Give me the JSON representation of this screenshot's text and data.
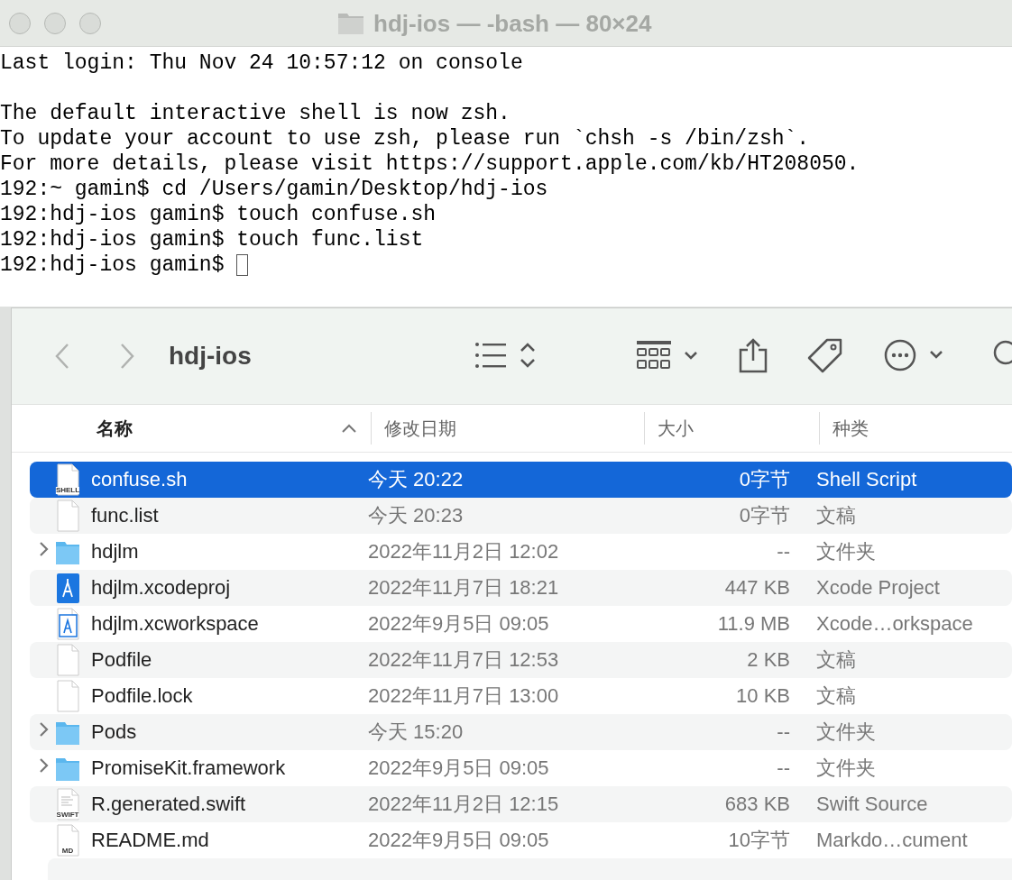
{
  "terminal": {
    "title": "hdj-ios — -bash — 80×24",
    "paragraphs": [
      [
        "Last login: Thu Nov 24 10:57:12 on console"
      ],
      [
        "The default interactive shell is now zsh.",
        "To update your account to use zsh, please run `chsh -s /bin/zsh`.",
        "For more details, please visit https://support.apple.com/kb/HT208050.",
        "192:~ gamin$ cd /Users/gamin/Desktop/hdj-ios",
        "192:hdj-ios gamin$ touch confuse.sh",
        "192:hdj-ios gamin$ touch func.list",
        "192:hdj-ios gamin$ "
      ]
    ]
  },
  "finder": {
    "title": "hdj-ios",
    "columns": [
      {
        "label": "名称",
        "sorted": true
      },
      {
        "label": "修改日期",
        "sorted": false
      },
      {
        "label": "大小",
        "sorted": false
      },
      {
        "label": "种类",
        "sorted": false
      }
    ],
    "rows": [
      {
        "kind": "shell",
        "icon_label": "SHELL",
        "name": "confuse.sh",
        "date": "今天 20:22",
        "size": "0字节",
        "file_type": "Shell Script",
        "selected": true
      },
      {
        "kind": "file",
        "name": "func.list",
        "date": "今天 20:23",
        "size": "0字节",
        "file_type": "文稿",
        "selected": false
      },
      {
        "kind": "folder",
        "expanded": false,
        "name": "hdjlm",
        "date": "2022年11月2日 12:02",
        "size": "--",
        "file_type": "文件夹",
        "selected": false
      },
      {
        "kind": "xcodeproj",
        "name": "hdjlm.xcodeproj",
        "date": "2022年11月7日 18:21",
        "size": "447 KB",
        "file_type": "Xcode Project",
        "selected": false
      },
      {
        "kind": "workspace",
        "name": "hdjlm.xcworkspace",
        "date": "2022年9月5日 09:05",
        "size": "11.9 MB",
        "file_type": "Xcode…orkspace",
        "selected": false
      },
      {
        "kind": "file",
        "name": "Podfile",
        "date": "2022年11月7日 12:53",
        "size": "2 KB",
        "file_type": "文稿",
        "selected": false
      },
      {
        "kind": "file",
        "name": "Podfile.lock",
        "date": "2022年11月7日 13:00",
        "size": "10 KB",
        "file_type": "文稿",
        "selected": false
      },
      {
        "kind": "folder",
        "expanded": false,
        "name": "Pods",
        "date": "今天 15:20",
        "size": "--",
        "file_type": "文件夹",
        "selected": false
      },
      {
        "kind": "folder",
        "expanded": false,
        "name": "PromiseKit.framework",
        "date": "2022年9月5日 09:05",
        "size": "--",
        "file_type": "文件夹",
        "selected": false
      },
      {
        "kind": "swift",
        "icon_label": "SWIFT",
        "name": "R.generated.swift",
        "date": "2022年11月2日 12:15",
        "size": "683 KB",
        "file_type": "Swift Source",
        "selected": false
      },
      {
        "kind": "md",
        "icon_label": "MD",
        "name": "README.md",
        "date": "2022年9月5日 09:05",
        "size": "10字节",
        "file_type": "Markdo…cument",
        "selected": false
      }
    ]
  }
}
